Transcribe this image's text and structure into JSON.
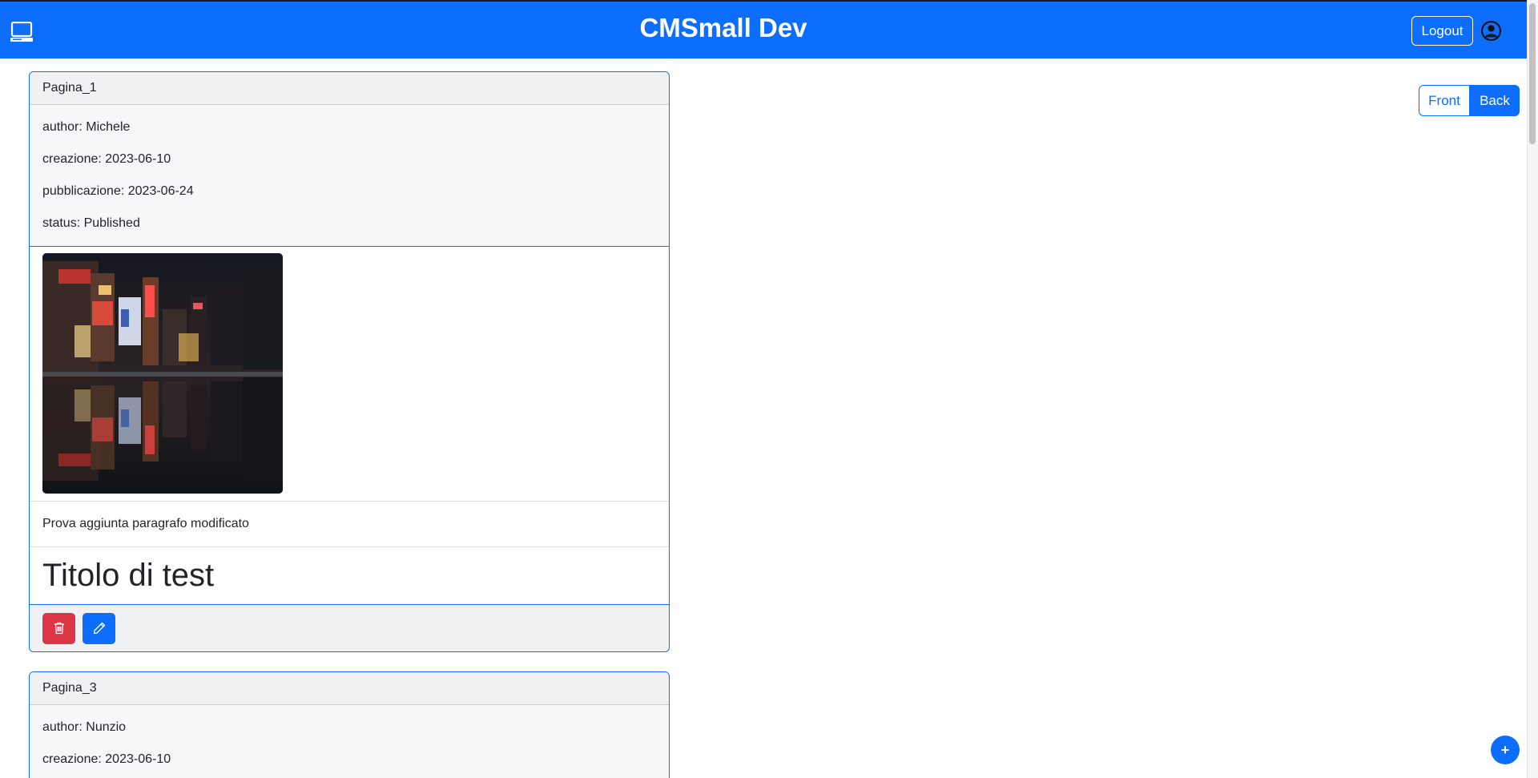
{
  "navbar": {
    "title": "CMSmall Dev",
    "logout_label": "Logout",
    "brand_icon": "laptop-icon",
    "user_icon": "user-circle-icon"
  },
  "view_toggle": {
    "front_label": "Front",
    "back_label": "Back",
    "active": "Back"
  },
  "pages": [
    {
      "title": "Pagina_1",
      "author": "author: Michele",
      "created": "creazione: 2023-06-10",
      "published": "pubblicazione: 2023-06-24",
      "status": "status: Published",
      "blocks": {
        "paragraph": "Prova aggiunta paragrafo modificato",
        "heading": "Titolo di test"
      }
    },
    {
      "title": "Pagina_3",
      "author": "author: Nunzio",
      "created": "creazione: 2023-06-10"
    }
  ],
  "actions": {
    "delete_icon": "trash-icon",
    "edit_icon": "pencil-icon",
    "add_label": "+"
  },
  "colors": {
    "primary": "#0d6efd",
    "danger": "#dc3545"
  }
}
